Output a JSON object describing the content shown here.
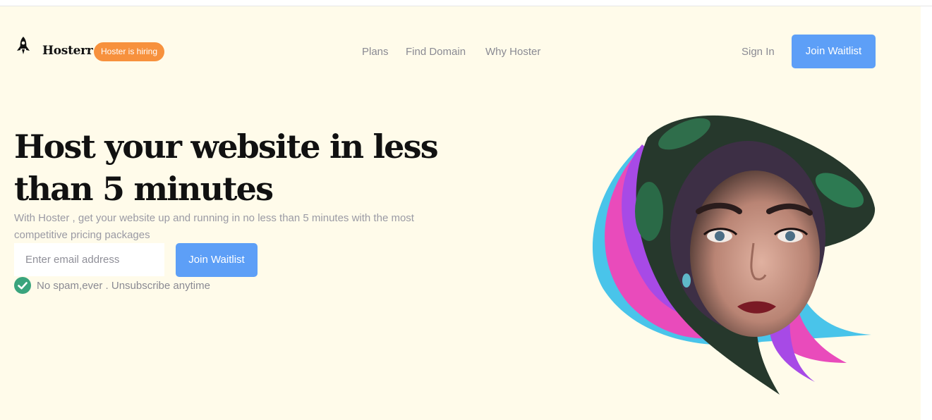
{
  "header": {
    "brand": "Hosterr",
    "badge": "Hoster is hiring",
    "nav": [
      "Plans",
      "Find Domain",
      "Why Hoster"
    ],
    "sign_in": "Sign In",
    "join_label": "Join Waitlist",
    "logo_icon": "rocket-icon"
  },
  "hero": {
    "headline": "Host your website in less than 5 minutes",
    "subtext": "With Hoster , get your website up and running in no less than 5 minutes with the most competitive pricing packages",
    "email_placeholder": "Enter email address",
    "join_label": "Join Waitlist",
    "note": "No spam,ever . Unsubscribe anytime",
    "note_icon": "check-circle-icon"
  },
  "colors": {
    "background": "#fffbea",
    "accent_blue": "#5d9ff7",
    "badge_orange": "#f7913d",
    "check_green": "#3aa47d",
    "swirl_cyan": "#49c4ea",
    "swirl_pink": "#e94bbb",
    "swirl_purple": "#a74ae6"
  }
}
